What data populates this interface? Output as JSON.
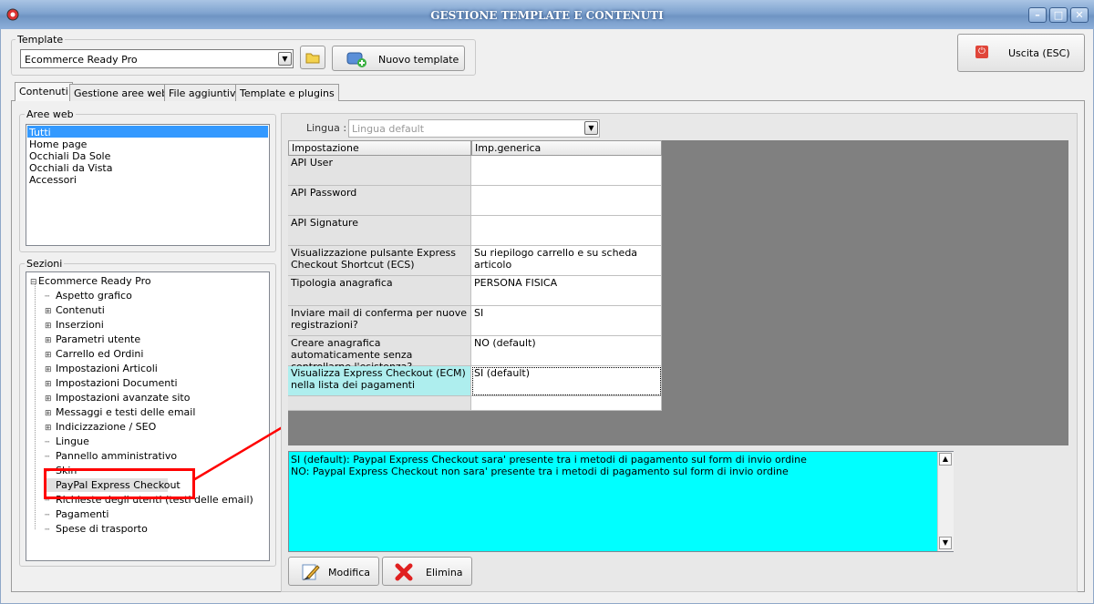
{
  "window": {
    "title": "GESTIONE TEMPLATE E CONTENUTI"
  },
  "template_group": {
    "label": "Template",
    "selected": "Ecommerce Ready Pro",
    "new_button": "Nuovo template"
  },
  "exit_button": "Uscita (ESC)",
  "tabs": [
    "Contenuti",
    "Gestione aree web",
    "File aggiuntivi",
    "Template e plugins"
  ],
  "aree_web": {
    "label": "Aree web",
    "items": [
      "Tutti",
      "Home page",
      "Occhiali Da Sole",
      "Occhiali da Vista",
      "Accessori"
    ],
    "selected_index": 0
  },
  "sezioni": {
    "label": "Sezioni",
    "root": "Ecommerce Ready Pro",
    "items": [
      {
        "label": "Aspetto grafico",
        "expandable": false
      },
      {
        "label": "Contenuti",
        "expandable": true
      },
      {
        "label": "Inserzioni",
        "expandable": true
      },
      {
        "label": "Parametri utente",
        "expandable": true
      },
      {
        "label": "Carrello ed Ordini",
        "expandable": true
      },
      {
        "label": "Impostazioni Articoli",
        "expandable": true
      },
      {
        "label": "Impostazioni Documenti",
        "expandable": true
      },
      {
        "label": "Impostazioni avanzate sito",
        "expandable": true
      },
      {
        "label": "Messaggi e testi delle email",
        "expandable": true
      },
      {
        "label": "Indicizzazione / SEO",
        "expandable": true
      },
      {
        "label": "Lingue",
        "expandable": false
      },
      {
        "label": "Pannello amministrativo",
        "expandable": false
      },
      {
        "label": "Skin",
        "expandable": false
      },
      {
        "label": "PayPal Express Checkout",
        "expandable": false
      },
      {
        "label": "Richieste degli utenti (testi delle email)",
        "expandable": false
      },
      {
        "label": "Pagamenti",
        "expandable": false
      },
      {
        "label": "Spese di trasporto",
        "expandable": false
      }
    ],
    "selected": "PayPal Express Checkout"
  },
  "lingua": {
    "label": "Lingua :",
    "value": "Lingua default"
  },
  "grid": {
    "headers": [
      "Impostazione",
      "Imp.generica"
    ],
    "rows": [
      {
        "setting": "API User",
        "value": ""
      },
      {
        "setting": "API Password",
        "value": ""
      },
      {
        "setting": "API Signature",
        "value": ""
      },
      {
        "setting": "Visualizzazione pulsante Express Checkout Shortcut (ECS)",
        "value": "Su riepilogo carrello e su scheda articolo"
      },
      {
        "setting": "Tipologia anagrafica",
        "value": "PERSONA FISICA"
      },
      {
        "setting": "Inviare mail di conferma per nuove registrazioni?",
        "value": "SI"
      },
      {
        "setting": "Creare anagrafica automaticamente senza controllarne l'esistenza?",
        "value": "NO (default)"
      },
      {
        "setting": "Visualizza Express Checkout (ECM) nella lista dei pagamenti",
        "value": "SI (default)"
      }
    ],
    "selected_index": 7
  },
  "description": {
    "line1": "SI (default): Paypal Express Checkout sara' presente tra i metodi di pagamento sul form di invio ordine",
    "line2": "NO: Paypal Express Checkout non sara' presente tra i metodi di pagamento sul form di invio ordine"
  },
  "buttons": {
    "modifica": "Modifica",
    "elimina": "Elimina"
  },
  "colors": {
    "highlight": "#ff0000",
    "description_bg": "#00ffff",
    "selection": "#3399ff",
    "selected_row": "#aeeeee"
  }
}
